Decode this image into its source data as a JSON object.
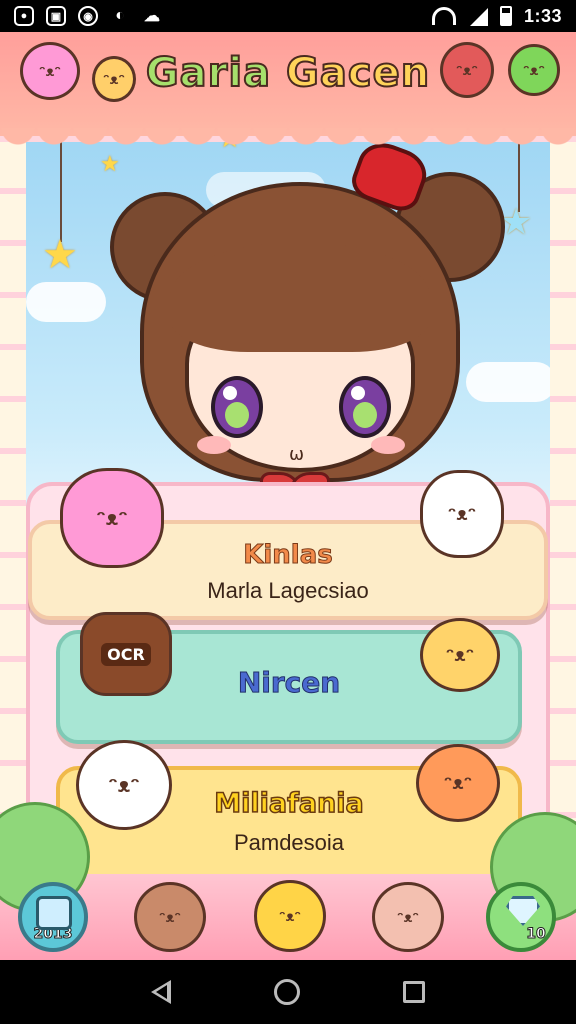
{
  "status_bar": {
    "time": "1:33",
    "icons": [
      "notification-icon",
      "gallery-icon",
      "media-icon",
      "message-icon",
      "cloud-icon",
      "wifi-icon",
      "signal-icon",
      "battery-icon"
    ]
  },
  "header": {
    "title_word1": "Garia",
    "title_word2": "Gacen"
  },
  "options": [
    {
      "title": "Kinlas",
      "subtitle": "Marla Lagecsiao"
    },
    {
      "title": "Nircen",
      "badge": "OCR"
    },
    {
      "title": "Miliafania",
      "subtitle": "Pamdesoia"
    }
  ],
  "bottom_bar": {
    "left_button_label": "2013",
    "right_button_label": "10"
  },
  "colors": {
    "header": "#ffb8a6",
    "panel": "#ffe2ea",
    "option_cream": "#fdecc8",
    "option_mint": "#a8e6d4",
    "option_yellow": "#ffe48f"
  }
}
